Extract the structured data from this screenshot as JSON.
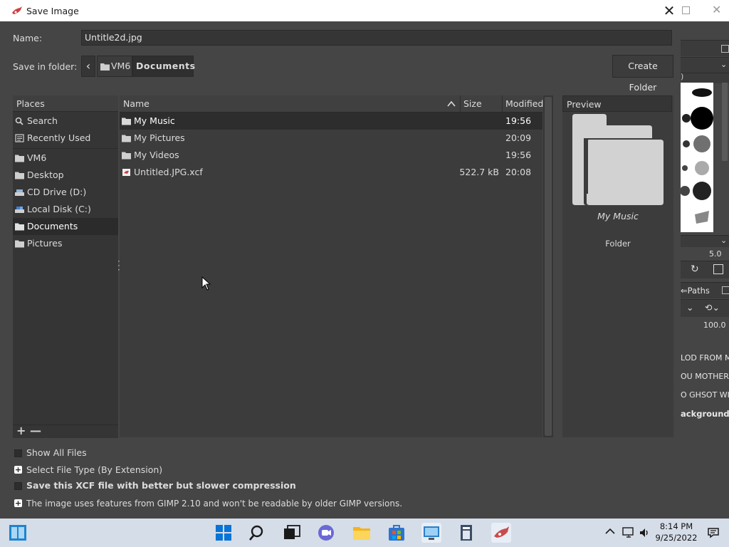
{
  "dialog": {
    "title": "Save Image",
    "close_glyph": "✕",
    "name_label": "Name:",
    "name_value": "Untitle2d.jpg",
    "save_in_label": "Save in folder:",
    "path": {
      "back_glyph": "‹",
      "segments": [
        "VM6",
        "Documents"
      ]
    },
    "create_folder": "Create Folder"
  },
  "places": {
    "header": "Places",
    "items": [
      {
        "label": "Search",
        "icon": "search-icon"
      },
      {
        "label": "Recently Used",
        "icon": "recent-icon"
      },
      {
        "label": "VM6",
        "icon": "folder-icon"
      },
      {
        "label": "Desktop",
        "icon": "folder-icon"
      },
      {
        "label": "CD Drive (D:)",
        "icon": "cd-drive-icon"
      },
      {
        "label": "Local Disk (C:)",
        "icon": "disk-icon"
      },
      {
        "label": "Documents",
        "icon": "folder-icon",
        "selected": true
      },
      {
        "label": "Pictures",
        "icon": "folder-icon"
      }
    ],
    "add_glyph": "+",
    "remove_glyph": "—"
  },
  "files": {
    "columns": {
      "name": "Name",
      "size": "Size",
      "modified": "Modified"
    },
    "rows": [
      {
        "name": "My Music",
        "size": "",
        "modified": "19:56",
        "type": "folder",
        "selected": true
      },
      {
        "name": "My Pictures",
        "size": "",
        "modified": "20:09",
        "type": "folder"
      },
      {
        "name": "My Videos",
        "size": "",
        "modified": "19:56",
        "type": "folder"
      },
      {
        "name": "Untitled.JPG.xcf",
        "size": "522.7 kB",
        "modified": "20:08",
        "type": "xcf"
      }
    ]
  },
  "preview": {
    "header": "Preview",
    "name": "My Music",
    "type": "Folder"
  },
  "options": {
    "show_all": "Show All Files",
    "file_type": "Select File Type (By Extension)",
    "compression": "Save this XCF file with better but slower compression",
    "compat": "The image uses features from GIMP 2.10 and won't be readable by older GIMP versions."
  },
  "background_window": {
    "value_1": "5.0",
    "paths_tab": "Paths",
    "value_2": "100.0",
    "layers": [
      "LOD FROM MC",
      "OU MOTHERFU",
      "O GHSOT WIL",
      "ackground"
    ]
  },
  "taskbar": {
    "time": "8:14 PM",
    "date": "9/25/2022",
    "accent": "#0078d4"
  }
}
